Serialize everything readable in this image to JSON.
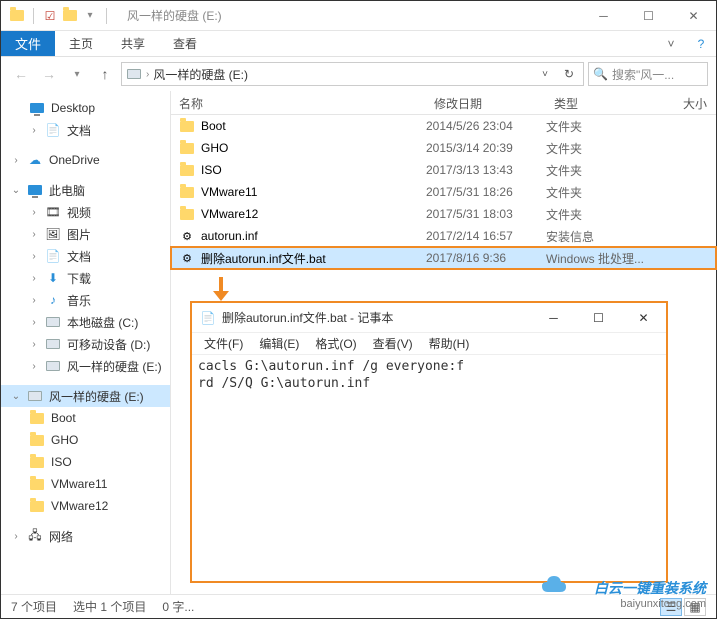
{
  "titlebar": {
    "title": "风一样的硬盘 (E:)"
  },
  "ribbon": {
    "file": "文件",
    "tabs": [
      "主页",
      "共享",
      "查看"
    ]
  },
  "addressbar": {
    "path": "风一样的硬盘 (E:)",
    "search_placeholder": "搜索\"风一..."
  },
  "tree": {
    "desktop": "Desktop",
    "docs": "文档",
    "onedrive": "OneDrive",
    "thispc": "此电脑",
    "video": "视频",
    "pictures": "图片",
    "docs2": "文档",
    "downloads": "下载",
    "music": "音乐",
    "localc": "本地磁盘 (C:)",
    "removd": "可移动设备 (D:)",
    "drivee": "风一样的硬盘 (E:)",
    "drivee2": "风一样的硬盘 (E:)",
    "boot": "Boot",
    "gho": "GHO",
    "iso": "ISO",
    "vm11": "VMware11",
    "vm12": "VMware12",
    "network": "网络"
  },
  "columns": {
    "name": "名称",
    "date": "修改日期",
    "type": "类型",
    "size": "大小"
  },
  "files": [
    {
      "name": "Boot",
      "date": "2014/5/26 23:04",
      "type": "文件夹",
      "icon": "folder"
    },
    {
      "name": "GHO",
      "date": "2015/3/14 20:39",
      "type": "文件夹",
      "icon": "folder"
    },
    {
      "name": "ISO",
      "date": "2017/3/13 13:43",
      "type": "文件夹",
      "icon": "folder"
    },
    {
      "name": "VMware11",
      "date": "2017/5/31 18:26",
      "type": "文件夹",
      "icon": "folder"
    },
    {
      "name": "VMware12",
      "date": "2017/5/31 18:03",
      "type": "文件夹",
      "icon": "folder"
    },
    {
      "name": "autorun.inf",
      "date": "2017/2/14 16:57",
      "type": "安装信息",
      "icon": "inf"
    },
    {
      "name": "删除autorun.inf文件.bat",
      "date": "2017/8/16 9:36",
      "type": "Windows 批处理...",
      "icon": "bat",
      "selected": true
    }
  ],
  "statusbar": {
    "count": "7 个项目",
    "selection": "选中 1 个项目",
    "size": "0 字..."
  },
  "notepad": {
    "title": "删除autorun.inf文件.bat - 记事本",
    "menu": [
      "文件(F)",
      "编辑(E)",
      "格式(O)",
      "查看(V)",
      "帮助(H)"
    ],
    "content": "cacls G:\\autorun.inf /g everyone:f\nrd /S/Q G:\\autorun.inf"
  },
  "watermark": {
    "line1": "白云一键重装系统",
    "line2": "baiyunxitong.com"
  }
}
